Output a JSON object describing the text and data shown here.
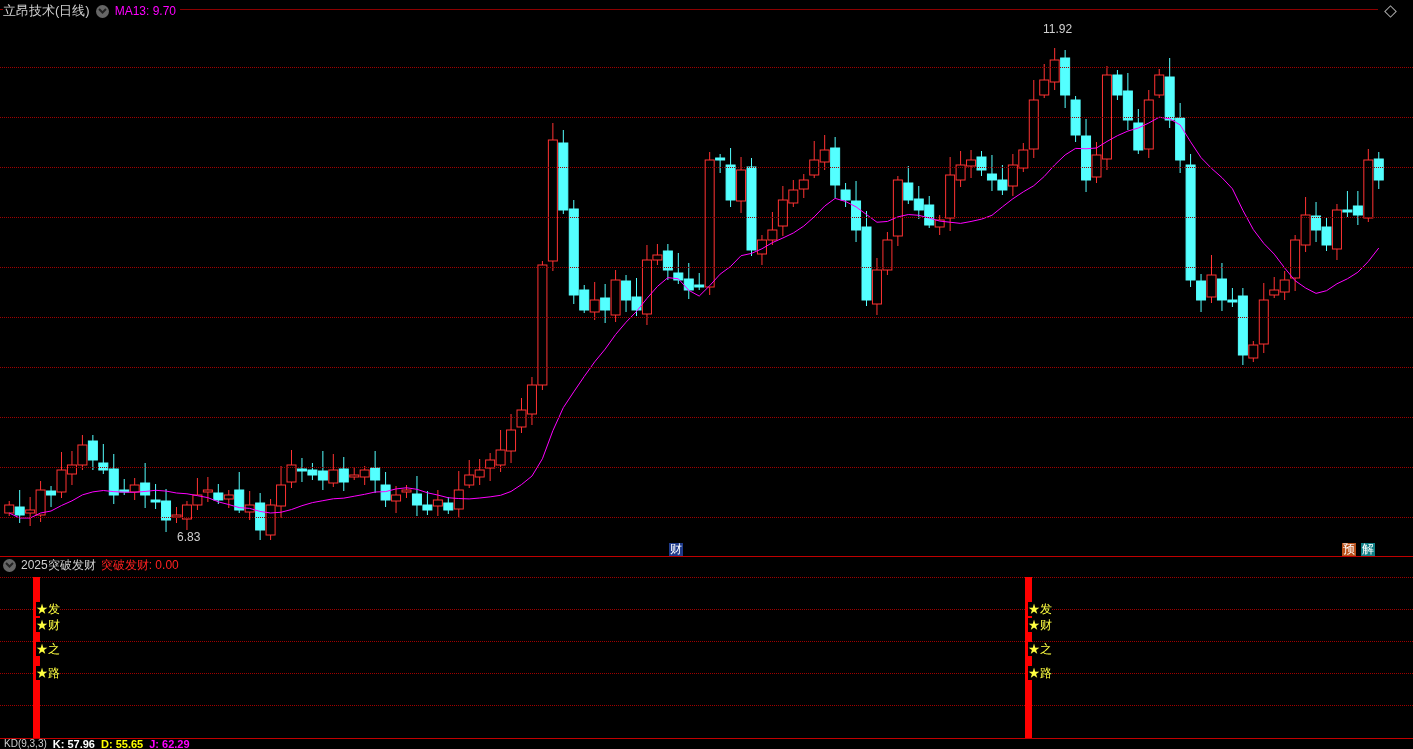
{
  "main_panel": {
    "title": "立昂技术(日线)",
    "indicator": "MA13: 9.70",
    "high_label": "11.92",
    "low_label": "6.83",
    "markers": [
      {
        "text": "财",
        "color": "#1e3a8a"
      },
      {
        "text": "预",
        "color": "#b8501a"
      },
      {
        "text": "解",
        "color": "#0f7f86"
      }
    ]
  },
  "signal_panel": {
    "title": "2025突破发财",
    "indicator": "突破发财: 0.00",
    "signals": [
      {
        "labels": [
          "★发",
          "★财",
          "★之",
          "★路"
        ]
      },
      {
        "labels": [
          "★发",
          "★财",
          "★之",
          "★路"
        ]
      }
    ]
  },
  "kd_panel": {
    "title": "KD(9,3,3)",
    "values": [
      {
        "text": "K: 57.96",
        "color": "#ffffff"
      },
      {
        "text": "D: 55.65",
        "color": "#ffff00"
      },
      {
        "text": "J: 62.29",
        "color": "#ff00ff"
      }
    ]
  }
}
